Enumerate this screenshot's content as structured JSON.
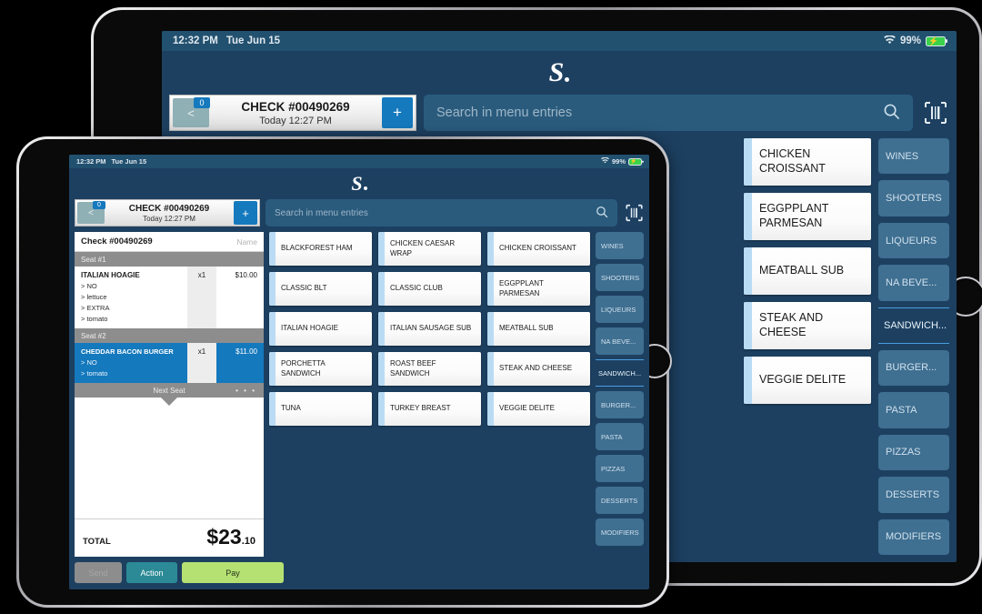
{
  "status_bar": {
    "time": "12:32 PM",
    "date": "Tue Jun 15",
    "battery": "99%",
    "wifi_icon": "wifi-icon",
    "battery_icon": "battery-charging-icon"
  },
  "brand": {
    "logo_letter": "S",
    "logo_name": "squirrel-logo"
  },
  "toolbar": {
    "back_icon": "<",
    "back_badge": "0",
    "check_number": "CHECK #00490269",
    "check_time": "Today 12:27 PM",
    "add_label": "+",
    "search_placeholder": "Search in menu entries",
    "search_icon": "search-icon",
    "barcode_icon": "barcode-scan-icon"
  },
  "order": {
    "check_label": "Check #00490269",
    "name_placeholder": "Name",
    "seats": [
      {
        "label": "Seat #1",
        "items": [
          {
            "name": "ITALIAN HOAGIE",
            "qty": "x1",
            "price": "$10.00",
            "selected": false,
            "modifiers": [
              "> NO",
              "> lettuce",
              "> EXTRA",
              "> tomato"
            ]
          }
        ]
      },
      {
        "label": "Seat #2",
        "items": [
          {
            "name": "CHEDDAR BACON BURGER",
            "qty": "x1",
            "price": "$11.00",
            "selected": true,
            "modifiers": [
              "> NO",
              "> tomato"
            ]
          }
        ]
      }
    ],
    "next_seat_label": "Next Seat",
    "next_seat_more": "• • •",
    "total_label": "TOTAL",
    "total_dollars": "$23",
    "total_cents": ".10",
    "buttons": {
      "send": "Send",
      "action": "Action",
      "pay": "Pay"
    }
  },
  "menu": {
    "items": [
      "BLACKFOREST HAM",
      "CHICKEN CAESAR WRAP",
      "CHICKEN CROISSANT",
      "CLASSIC BLT",
      "CLASSIC CLUB",
      "EGGPPLANT PARMESAN",
      "ITALIAN HOAGIE",
      "ITALIAN SAUSAGE SUB",
      "MEATBALL SUB",
      "PORCHETTA SANDWICH",
      "ROAST BEEF SANDWICH",
      "STEAK AND CHEESE",
      "TUNA",
      "TURKEY BREAST",
      "VEGGIE DELITE"
    ],
    "back_items": [
      "CHICKEN CROISSANT",
      "EGGPPLANT PARMESAN",
      "MEATBALL SUB",
      "STEAK AND CHEESE",
      "VEGGIE DELITE"
    ],
    "categories": [
      {
        "label": "WINES",
        "active": false
      },
      {
        "label": "SHOOTERS",
        "active": false
      },
      {
        "label": "LIQUEURS",
        "active": false
      },
      {
        "label": "NA BEVE...",
        "active": false
      },
      {
        "label": "SANDWICH...",
        "active": true
      },
      {
        "label": "BURGER...",
        "active": false
      },
      {
        "label": "PASTA",
        "active": false
      },
      {
        "label": "PIZZAS",
        "active": false
      },
      {
        "label": "DESSERTS",
        "active": false
      },
      {
        "label": "MODIFIERS",
        "active": false
      }
    ]
  },
  "colors": {
    "app_bg": "#1d4061",
    "status_bar": "#22506f",
    "accent_blue": "#1579bd",
    "pay_green": "#b5e173",
    "action_teal": "#2b8a96",
    "tile_accent": "#b9dcf4",
    "category": "#3f6f91"
  }
}
